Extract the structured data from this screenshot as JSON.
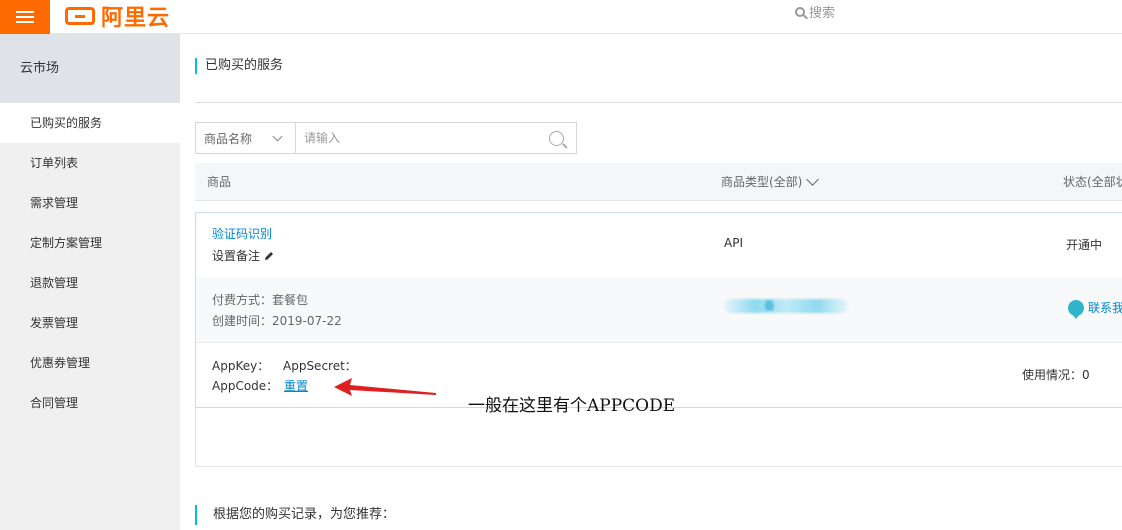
{
  "header": {
    "logo_text": "阿里云",
    "search_label": "搜索"
  },
  "sidebar": {
    "title": "云市场",
    "items": [
      {
        "label": "已购买的服务"
      },
      {
        "label": "订单列表"
      },
      {
        "label": "需求管理"
      },
      {
        "label": "定制方案管理"
      },
      {
        "label": "退款管理"
      },
      {
        "label": "发票管理"
      },
      {
        "label": "优惠券管理"
      },
      {
        "label": "合同管理"
      }
    ]
  },
  "main": {
    "page_title": "已购买的服务",
    "filter": {
      "select_value": "商品名称",
      "placeholder": "请输入"
    },
    "table": {
      "headers": {
        "product": "商品",
        "type": "商品类型(全部)",
        "status": "状态(全部状"
      }
    },
    "service": {
      "name": "验证码识别",
      "note_label": "设置备注",
      "type": "API",
      "status": "开通中",
      "pay_method": "付费方式：套餐包",
      "created": "创建时间：2019-07-22",
      "blurred_text": "备",
      "contact": "联系我",
      "appkey_label": "AppKey：",
      "appsecret_label": "AppSecret：",
      "appcode_label": "AppCode：",
      "reset_label": "重置",
      "usage": "使用情况：0"
    },
    "annotation": "一般在这里有个APPCODE",
    "recommend": "根据您的购买记录，为您推荐："
  },
  "colors": {
    "brand": "#ff6a00",
    "link": "#0088cc",
    "accent": "#00c1de",
    "arrow": "#e02020"
  }
}
